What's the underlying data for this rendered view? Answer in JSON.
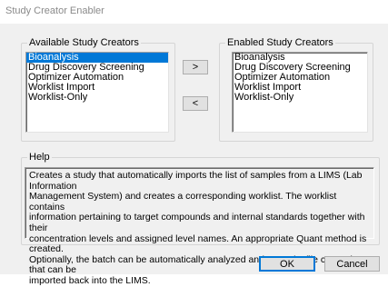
{
  "window": {
    "title": "Study Creator Enabler"
  },
  "available": {
    "label": "Available Study Creators",
    "items": [
      "Bioanalysis",
      "Drug Discovery Screening",
      "Optimizer Automation",
      "Worklist Import",
      "Worklist-Only"
    ],
    "selected": "Bioanalysis"
  },
  "enabled": {
    "label": "Enabled Study Creators",
    "items": [
      "Bioanalysis",
      "Drug Discovery Screening",
      "Optimizer Automation",
      "Worklist Import",
      "Worklist-Only"
    ]
  },
  "buttons": {
    "add": ">",
    "remove": "<",
    "ok": "OK",
    "cancel": "Cancel"
  },
  "help": {
    "label": "Help",
    "text": "Creates a study that automatically imports the list of samples from a LIMS (Lab Information\nManagement System) and creates a corresponding worklist.  The worklist contains\ninformation pertaining to target compounds and internal standards together with their\nconcentration levels and assigned level names.  An appropriate Quant method is created.\nOptionally, the batch can be automatically analyzed and a results file created that can be\nimported back into the LIMS."
  }
}
